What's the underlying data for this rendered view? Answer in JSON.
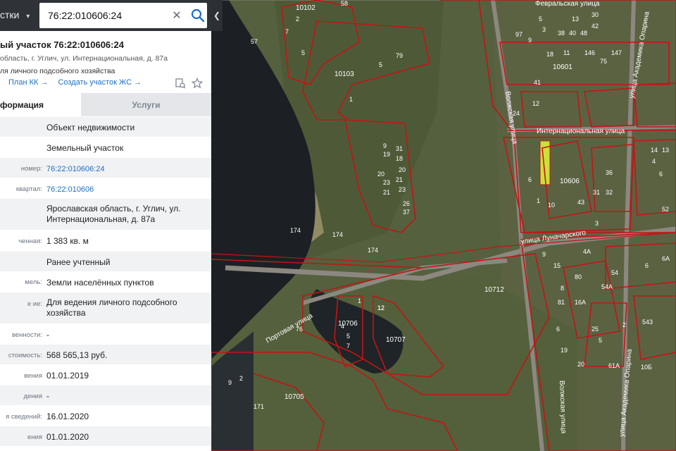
{
  "search": {
    "type_label": "стки",
    "query": "76:22:010606:24"
  },
  "panel": {
    "title": "ый участок 76:22:010606:24",
    "address": "область, г. Углич, ул. Интернациональная, д. 87а",
    "use": "ля личного подсобного хозяйства",
    "links": {
      "plan": "План КК →",
      "create": "Создать участок ЖС →"
    },
    "tabs": {
      "info": "формация",
      "services": "Услуги"
    },
    "rows": [
      {
        "label": "",
        "value": "Объект недвижимости"
      },
      {
        "label": "",
        "value": "Земельный участок"
      },
      {
        "label": "номер:",
        "value": "76:22:010606:24"
      },
      {
        "label": "квартал:",
        "value": "76:22:010606"
      },
      {
        "label": "",
        "value": "Ярославская область, г. Углич, ул. Интернациональная, д. 87а"
      },
      {
        "label": "ченная:",
        "value": "1 383 кв. м"
      },
      {
        "label": "",
        "value": "Ранее учтенный"
      },
      {
        "label": "мель:",
        "value": "Земли населённых пунктов"
      },
      {
        "label": "е ие:",
        "value": "Для ведения личного подсобного хозяйства"
      },
      {
        "label": "венности:",
        "value": "-"
      },
      {
        "label": "стоимость:",
        "value": "568 565,13 руб."
      },
      {
        "label": "вения",
        "value": "01.01.2019"
      },
      {
        "label": "дения",
        "value": "-"
      },
      {
        "label": "я сведений:",
        "value": "16.01.2020"
      },
      {
        "label": "ения",
        "value": "01.01.2020"
      }
    ]
  },
  "map": {
    "quarters": [
      "10102",
      "10103",
      "10601",
      "10606",
      "10706",
      "10707",
      "10705",
      "10712"
    ],
    "streets": [
      "Февральская улица",
      "Интернациональная улица",
      "улица Луначарского",
      "Портовая улица",
      "Волжская улица",
      "Волжская улица",
      "улица Академика Опарина",
      "улица Академика Опарина"
    ],
    "parcels": [
      "58",
      "57",
      "7",
      "2",
      "5",
      "5",
      "79",
      "1",
      "5",
      "3",
      "97",
      "9",
      "38",
      "40",
      "48",
      "42",
      "13",
      "30",
      "146",
      "147",
      "11",
      "18",
      "41",
      "24",
      "75",
      "12",
      "9",
      "31",
      "19",
      "18",
      "21",
      "20",
      "23",
      "20",
      "23",
      "21",
      "37",
      "26",
      "174",
      "174",
      "4A",
      "54",
      "54A",
      "9",
      "6",
      "1",
      "10",
      "43",
      "36",
      "32",
      "31",
      "3",
      "52",
      "13",
      "14",
      "4",
      "6",
      "12",
      "76",
      "4",
      "5",
      "7",
      "15",
      "80",
      "81",
      "8",
      "16A",
      "6",
      "5",
      "19",
      "20",
      "25",
      "2",
      "543",
      "61A",
      "10Б",
      "9",
      "2",
      "171",
      "12",
      "6A",
      "6",
      "1",
      "174"
    ],
    "colors": {
      "boundary": "#c41414",
      "selected": "#c8e23a",
      "water": "#1c2024",
      "sand": "#c8b48a"
    }
  }
}
